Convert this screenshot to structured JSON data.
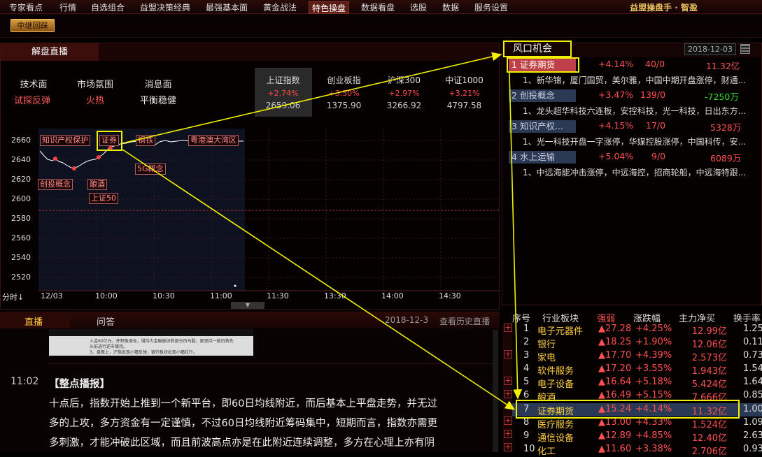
{
  "menu": {
    "items": [
      "专家看点",
      "行情",
      "自选组合",
      "益盟决策经典",
      "最强基本面",
      "黄金战法",
      "特色操盘",
      "数据看盘",
      "选股",
      "数据",
      "服务设置"
    ],
    "brand": "益盟操盘手 · 智盈"
  },
  "toolbar": {
    "relay_button": "中继回踩"
  },
  "left_panel": {
    "tab_title": "解盘直播",
    "stats": [
      {
        "label": "技术面",
        "value": "试探反弹"
      },
      {
        "label": "市场氛围",
        "value": "火热"
      },
      {
        "label": "消息面",
        "value": "平衡稳健"
      }
    ],
    "indices": [
      {
        "name": "上证指数",
        "change": "+2.74%",
        "value": "2659.06"
      },
      {
        "name": "创业板指",
        "change": "+3.50%",
        "value": "1375.90"
      },
      {
        "name": "沪深300",
        "change": "+2.97%",
        "value": "3266.92"
      },
      {
        "name": "中证1000",
        "change": "+3.21%",
        "value": "4797.58"
      }
    ],
    "chart": {
      "y_ticks": [
        "2660",
        "2640",
        "2620",
        "2600",
        "2580",
        "2560",
        "2540",
        "2520"
      ],
      "x_ticks": [
        "12/03",
        "10:00",
        "10:30",
        "11:00",
        "11:30",
        "13:30",
        "14:00",
        "14:30"
      ],
      "period_label": "分时",
      "annotations": [
        "知识产权保护",
        "证券",
        "钢铁",
        "粤港澳大湾区",
        "创投概念",
        "酿酒",
        "5G概念",
        "上证50"
      ]
    }
  },
  "bottom_left": {
    "tabs": [
      "直播",
      "问答"
    ],
    "date": "2018-12-3",
    "history_link": "查看历史直播",
    "thumb_lines": [
      "入金60亿元，并积极调仓，增持大金融板块和部分白马股，更坚持一些白首先",
      "头前进行逆市增持。",
      "3、盘面上，沪指出现小幅反弹，银行板块出现小幅拉升。"
    ],
    "time": "11:02",
    "headline": "【整点播报】",
    "body": [
      "十点后，指数开始上推到一个新平台，即60日均线附近，而后基本上平盘走势，并无过",
      "多的上攻，多方资金有一定谨慎，不过60日均线附近筹码集中，短期而言，指数亦需更",
      "多刺激，才能冲破此区域，而且前波高点亦是在此附近连续调整，多方在心理上亦有阴"
    ]
  },
  "opportunity": {
    "title": "风口机会",
    "date": "2018-12-03",
    "themes": [
      {
        "rank": "1",
        "name": "证券期货",
        "change": "+4.14%",
        "count": "40/0",
        "flow": "11.32亿",
        "desc": "1、新华锦，厦门国贸，美尔雅，中国中期开盘涨停，财通..."
      },
      {
        "rank": "2",
        "name": "创投概念",
        "change": "+3.47%",
        "count": "139/0",
        "flow": "-7250万",
        "desc": "1、龙头超华科技六连板，安控科技，光一科技，日出东方..."
      },
      {
        "rank": "3",
        "name": "知识产权...",
        "change": "+4.15%",
        "count": "17/0",
        "flow": "5328万",
        "desc": "1、光一科技开盘一字涨停，华媒控股涨停，中国科传，安..."
      },
      {
        "rank": "4",
        "name": "水上运输",
        "change": "+5.04%",
        "count": "9/0",
        "flow": "6089万",
        "desc": "1、中远海能冲击涨停，中远海控，招商轮船，中远海特跟..."
      }
    ]
  },
  "sector_table": {
    "headers": [
      "序号",
      "行业板块",
      "强弱",
      "涨跌幅",
      "主力净买",
      "换手率"
    ],
    "rows": [
      {
        "no": "1",
        "name": "电子元器件",
        "strength": "▲27.28",
        "change": "+4.25%",
        "flow": "12.99亿",
        "turnover": "1.25"
      },
      {
        "no": "2",
        "name": "银行",
        "strength": "▲18.25",
        "change": "+1.90%",
        "flow": "12.06亿",
        "turnover": "0.11"
      },
      {
        "no": "3",
        "name": "家电",
        "strength": "▲17.70",
        "change": "+4.39%",
        "flow": "2.573亿",
        "turnover": "0.73"
      },
      {
        "no": "4",
        "name": "软件服务",
        "strength": "▲17.20",
        "change": "+3.55%",
        "flow": "1.943亿",
        "turnover": "1.54"
      },
      {
        "no": "5",
        "name": "电子设备",
        "strength": "▲16.64",
        "change": "+5.18%",
        "flow": "5.424亿",
        "turnover": "1.64"
      },
      {
        "no": "6",
        "name": "酿酒",
        "strength": "▲16.49",
        "change": "+5.15%",
        "flow": "7.666亿",
        "turnover": "0.85"
      },
      {
        "no": "7",
        "name": "证券期货",
        "strength": "▲15.24",
        "change": "+4.14%",
        "flow": "11.32亿",
        "turnover": "1.00"
      },
      {
        "no": "8",
        "name": "医疗服务",
        "strength": "▲13.00",
        "change": "+4.33%",
        "flow": "1.524亿",
        "turnover": "1.09"
      },
      {
        "no": "9",
        "name": "通信设备",
        "strength": "▲12.89",
        "change": "+4.85%",
        "flow": "12.40亿",
        "turnover": "2.63"
      },
      {
        "no": "10",
        "name": "化工",
        "strength": "▲11.60",
        "change": "+3.38%",
        "flow": "2.706亿",
        "turnover": "0.93"
      }
    ]
  },
  "colors": {
    "up": "#ff4a4a",
    "highlight": "#f0f000",
    "theme_bg": "#2a3a55"
  }
}
